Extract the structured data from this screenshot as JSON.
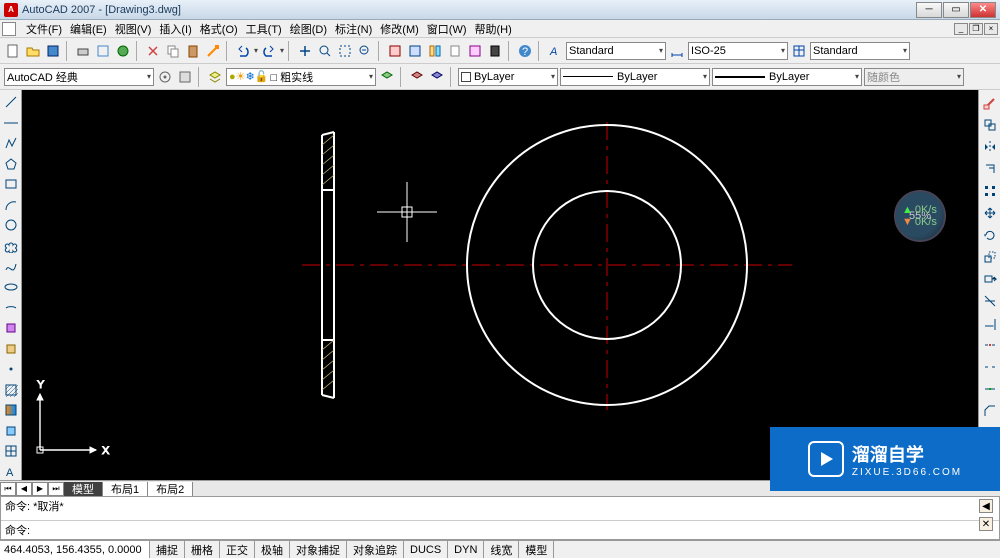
{
  "app": {
    "title": "AutoCAD 2007 - [Drawing3.dwg]",
    "icon_letter": "A"
  },
  "menu": {
    "file": "文件(F)",
    "edit": "编辑(E)",
    "view": "视图(V)",
    "insert": "插入(I)",
    "format": "格式(O)",
    "tools": "工具(T)",
    "draw": "绘图(D)",
    "dimension": "标注(N)",
    "modify": "修改(M)",
    "window": "窗口(W)",
    "help": "帮助(H)"
  },
  "toolbar1": {
    "text_style": "Standard",
    "dim_style": "ISO-25",
    "table_style": "Standard"
  },
  "toolbar2": {
    "workspace": "AutoCAD 经典",
    "layer_name": "□ 粗实线",
    "layer_status": "ByLayer",
    "linetype": "ByLayer",
    "lineweight": "ByLayer",
    "color": "随颜色"
  },
  "tabs": {
    "model": "模型",
    "layout1": "布局1",
    "layout2": "布局2"
  },
  "command": {
    "history_line": "命令: *取消*",
    "prompt": "命令:"
  },
  "status": {
    "coords": "464.4053, 156.4355, 0.0000",
    "snap": "捕捉",
    "grid": "栅格",
    "ortho": "正交",
    "polar": "极轴",
    "osnap": "对象捕捉",
    "otrack": "对象追踪",
    "ducs": "DUCS",
    "dyn": "DYN",
    "lwt": "线宽",
    "model": "模型"
  },
  "ucs": {
    "x_label": "X",
    "y_label": "Y"
  },
  "net_badge": {
    "percent": "55%",
    "up": "0K/s",
    "down": "0K/s"
  },
  "watermark": {
    "main": "溜溜自学",
    "sub": "ZIXUE.3D66.COM"
  }
}
